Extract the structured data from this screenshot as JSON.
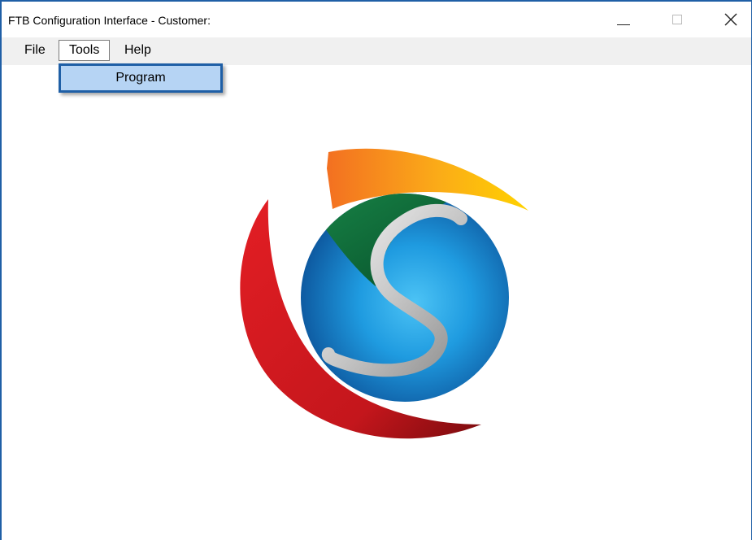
{
  "window": {
    "title": "FTB Configuration Interface - Customer:"
  },
  "menubar": {
    "items": [
      {
        "label": "File"
      },
      {
        "label": "Tools"
      },
      {
        "label": "Help"
      }
    ]
  },
  "tools_menu": {
    "items": [
      {
        "label": "Program"
      }
    ]
  },
  "logo": {
    "icon": "sphere-s-logo",
    "colors": {
      "red_arc": "#d7161c",
      "orange_arc": "#f37021",
      "yellow_arc": "#ffc20e",
      "green_cap": "#0b6e3b",
      "blue_sphere": "#1f9be0",
      "silver_s": "#d9d9d9"
    }
  },
  "colors": {
    "accent": "#1f5fa6",
    "menu_highlight": "#b6d4f4",
    "menubar_bg": "#f0f0f0"
  }
}
